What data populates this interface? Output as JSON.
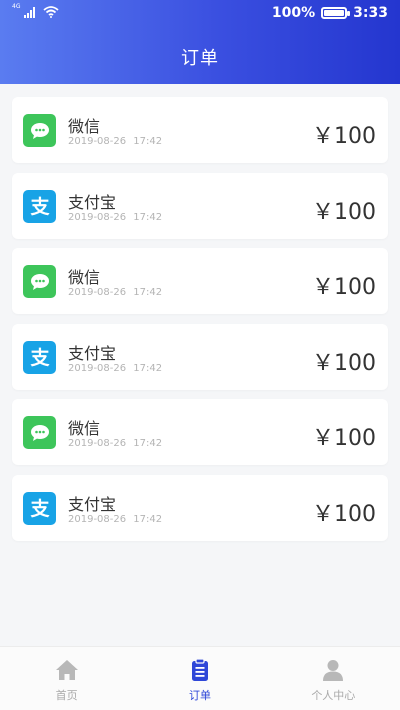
{
  "status_bar": {
    "network_type": "4G",
    "battery": "100%",
    "time": "3:33"
  },
  "header": {
    "title": "订单"
  },
  "orders": [
    {
      "method": "微信",
      "icon": "wechat-icon",
      "time": "2019-08-26 17:42",
      "amount": "￥100"
    },
    {
      "method": "支付宝",
      "icon": "alipay-icon",
      "time": "2019-08-26 17:42",
      "amount": "￥100"
    },
    {
      "method": "微信",
      "icon": "wechat-icon",
      "time": "2019-08-26 17:42",
      "amount": "￥100"
    },
    {
      "method": "支付宝",
      "icon": "alipay-icon",
      "time": "2019-08-26 17:42",
      "amount": "￥100"
    },
    {
      "method": "微信",
      "icon": "wechat-icon",
      "time": "2019-08-26 17:42",
      "amount": "￥100"
    },
    {
      "method": "支付宝",
      "icon": "alipay-icon",
      "time": "2019-08-26 17:42",
      "amount": "￥100"
    }
  ],
  "tabbar": {
    "active_index": 1,
    "items": [
      {
        "label": "首页",
        "icon": "home-icon"
      },
      {
        "label": "订单",
        "icon": "clipboard-icon"
      },
      {
        "label": "个人中心",
        "icon": "person-icon"
      }
    ]
  },
  "colors": {
    "header_start": "#5a7cf0",
    "header_end": "#2436cf",
    "wechat_green": "#3dc55a",
    "alipay_blue": "#18a3e6",
    "tab_active": "#2f47d8",
    "tab_inactive": "#a9a9a9"
  }
}
